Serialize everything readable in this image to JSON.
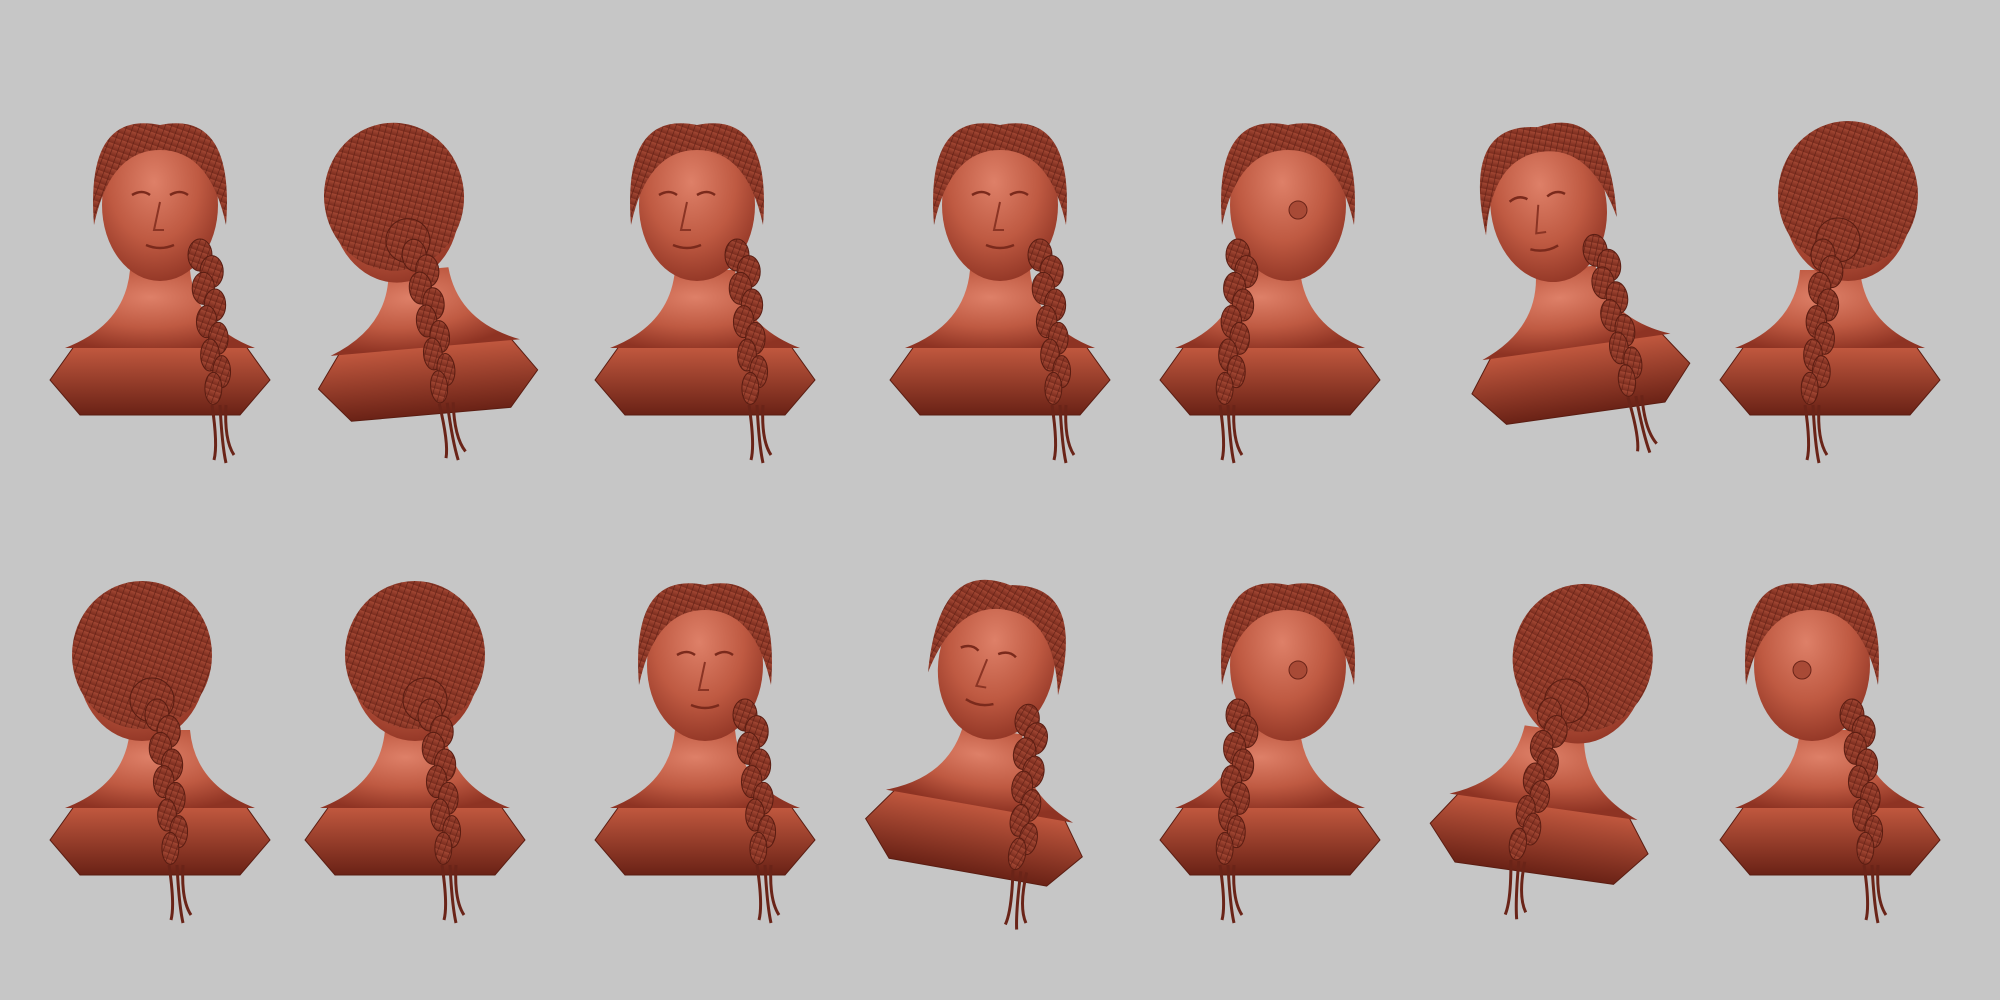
{
  "scene": {
    "background": "#c6c6c6",
    "clay_color": "#b5503a",
    "clay_light": "#d4745c",
    "clay_dark": "#6e2418",
    "rows": [
      {
        "views": [
          {
            "label": "front-view",
            "facing": "front",
            "tilt": 0
          },
          {
            "label": "left-profile-back-view",
            "facing": "back-left",
            "tilt": -5
          },
          {
            "label": "three-quarter-left-view",
            "facing": "three-quarter-left",
            "tilt": 0
          },
          {
            "label": "front-view-alt",
            "facing": "front",
            "tilt": 0
          },
          {
            "label": "right-profile-view",
            "facing": "right",
            "tilt": 0
          },
          {
            "label": "three-quarter-left-up-view",
            "facing": "three-quarter-left",
            "tilt": -8
          },
          {
            "label": "back-right-view",
            "facing": "back-right",
            "tilt": 0
          }
        ]
      },
      {
        "views": [
          {
            "label": "back-left-view",
            "facing": "back-left",
            "tilt": 0
          },
          {
            "label": "back-view",
            "facing": "back",
            "tilt": 0
          },
          {
            "label": "front-low-view",
            "facing": "front",
            "tilt": 0
          },
          {
            "label": "three-quarter-down-view",
            "facing": "three-quarter-left",
            "tilt": 10
          },
          {
            "label": "right-three-quarter-view",
            "facing": "right",
            "tilt": 0
          },
          {
            "label": "back-right-low-view",
            "facing": "back-right",
            "tilt": 8
          },
          {
            "label": "left-profile-view",
            "facing": "left",
            "tilt": 0
          }
        ]
      }
    ]
  }
}
